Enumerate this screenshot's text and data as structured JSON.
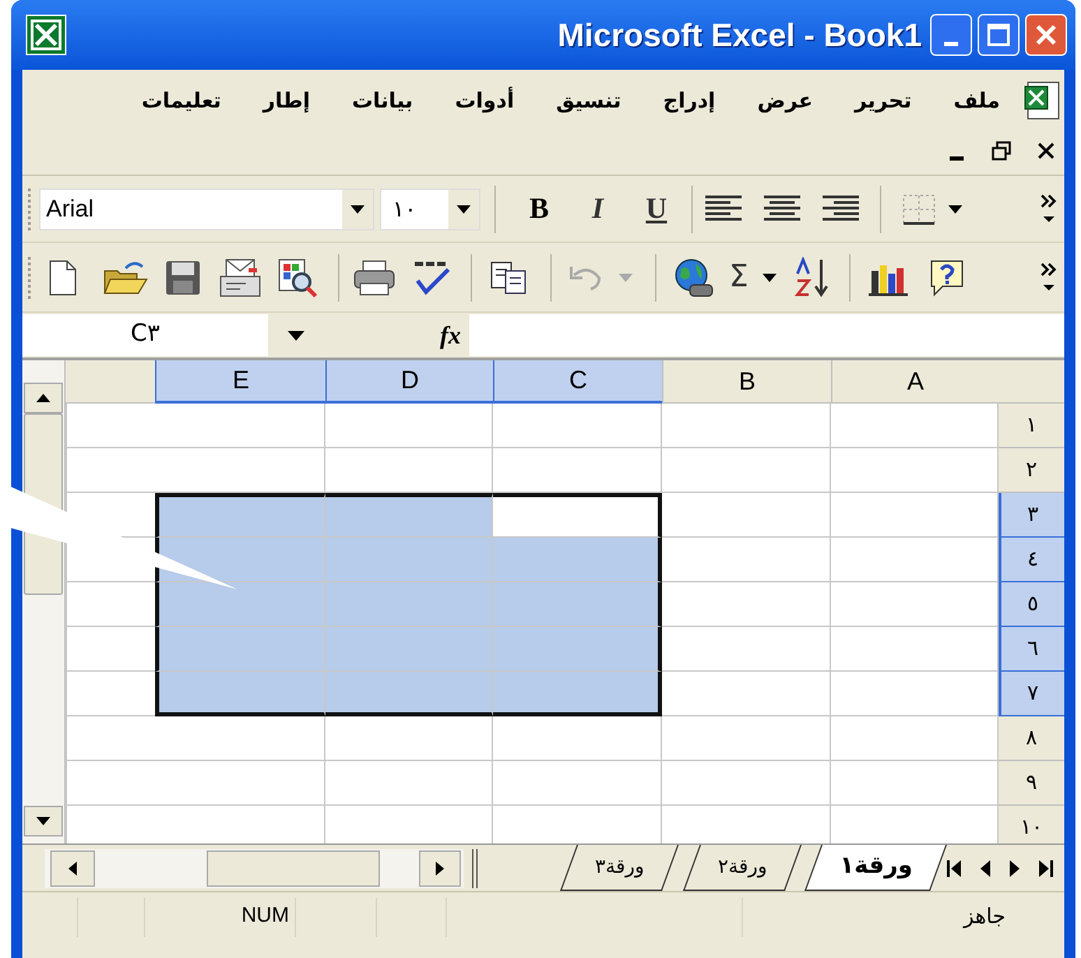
{
  "window": {
    "title": "Microsoft Excel - Book1"
  },
  "menu": [
    "ملف",
    "تحرير",
    "عرض",
    "إدراج",
    "تنسيق",
    "أدوات",
    "بيانات",
    "إطار",
    "تعليمات"
  ],
  "formatting_toolbar": {
    "font": "Arial",
    "font_size": "١٠",
    "bold": "B",
    "italic": "I",
    "underline": "U"
  },
  "standard_toolbar": {
    "autosum": "Σ"
  },
  "name_box": "C٣",
  "formula_label": "fx",
  "columns": [
    {
      "label": "A",
      "selected": false,
      "active": false
    },
    {
      "label": "B",
      "selected": false,
      "active": false
    },
    {
      "label": "C",
      "selected": true,
      "active": true
    },
    {
      "label": "D",
      "selected": true,
      "active": false
    },
    {
      "label": "E",
      "selected": true,
      "active": false
    }
  ],
  "rows": [
    {
      "label": "١",
      "selected": false,
      "active": false
    },
    {
      "label": "٢",
      "selected": false,
      "active": false
    },
    {
      "label": "٣",
      "selected": true,
      "active": true
    },
    {
      "label": "٤",
      "selected": true,
      "active": false
    },
    {
      "label": "٥",
      "selected": true,
      "active": false
    },
    {
      "label": "٦",
      "selected": true,
      "active": false
    },
    {
      "label": "٧",
      "selected": true,
      "active": false
    },
    {
      "label": "٨",
      "selected": false,
      "active": false
    },
    {
      "label": "٩",
      "selected": false,
      "active": false
    },
    {
      "label": "١٠",
      "selected": false,
      "active": false
    }
  ],
  "sheet_tabs": [
    {
      "label": "ورقة١",
      "selected": true
    },
    {
      "label": "ورقة٢",
      "selected": false
    },
    {
      "label": "ورقة٣",
      "selected": false
    }
  ],
  "status_bar": {
    "mode": "جاهز",
    "indicator": "NUM"
  }
}
